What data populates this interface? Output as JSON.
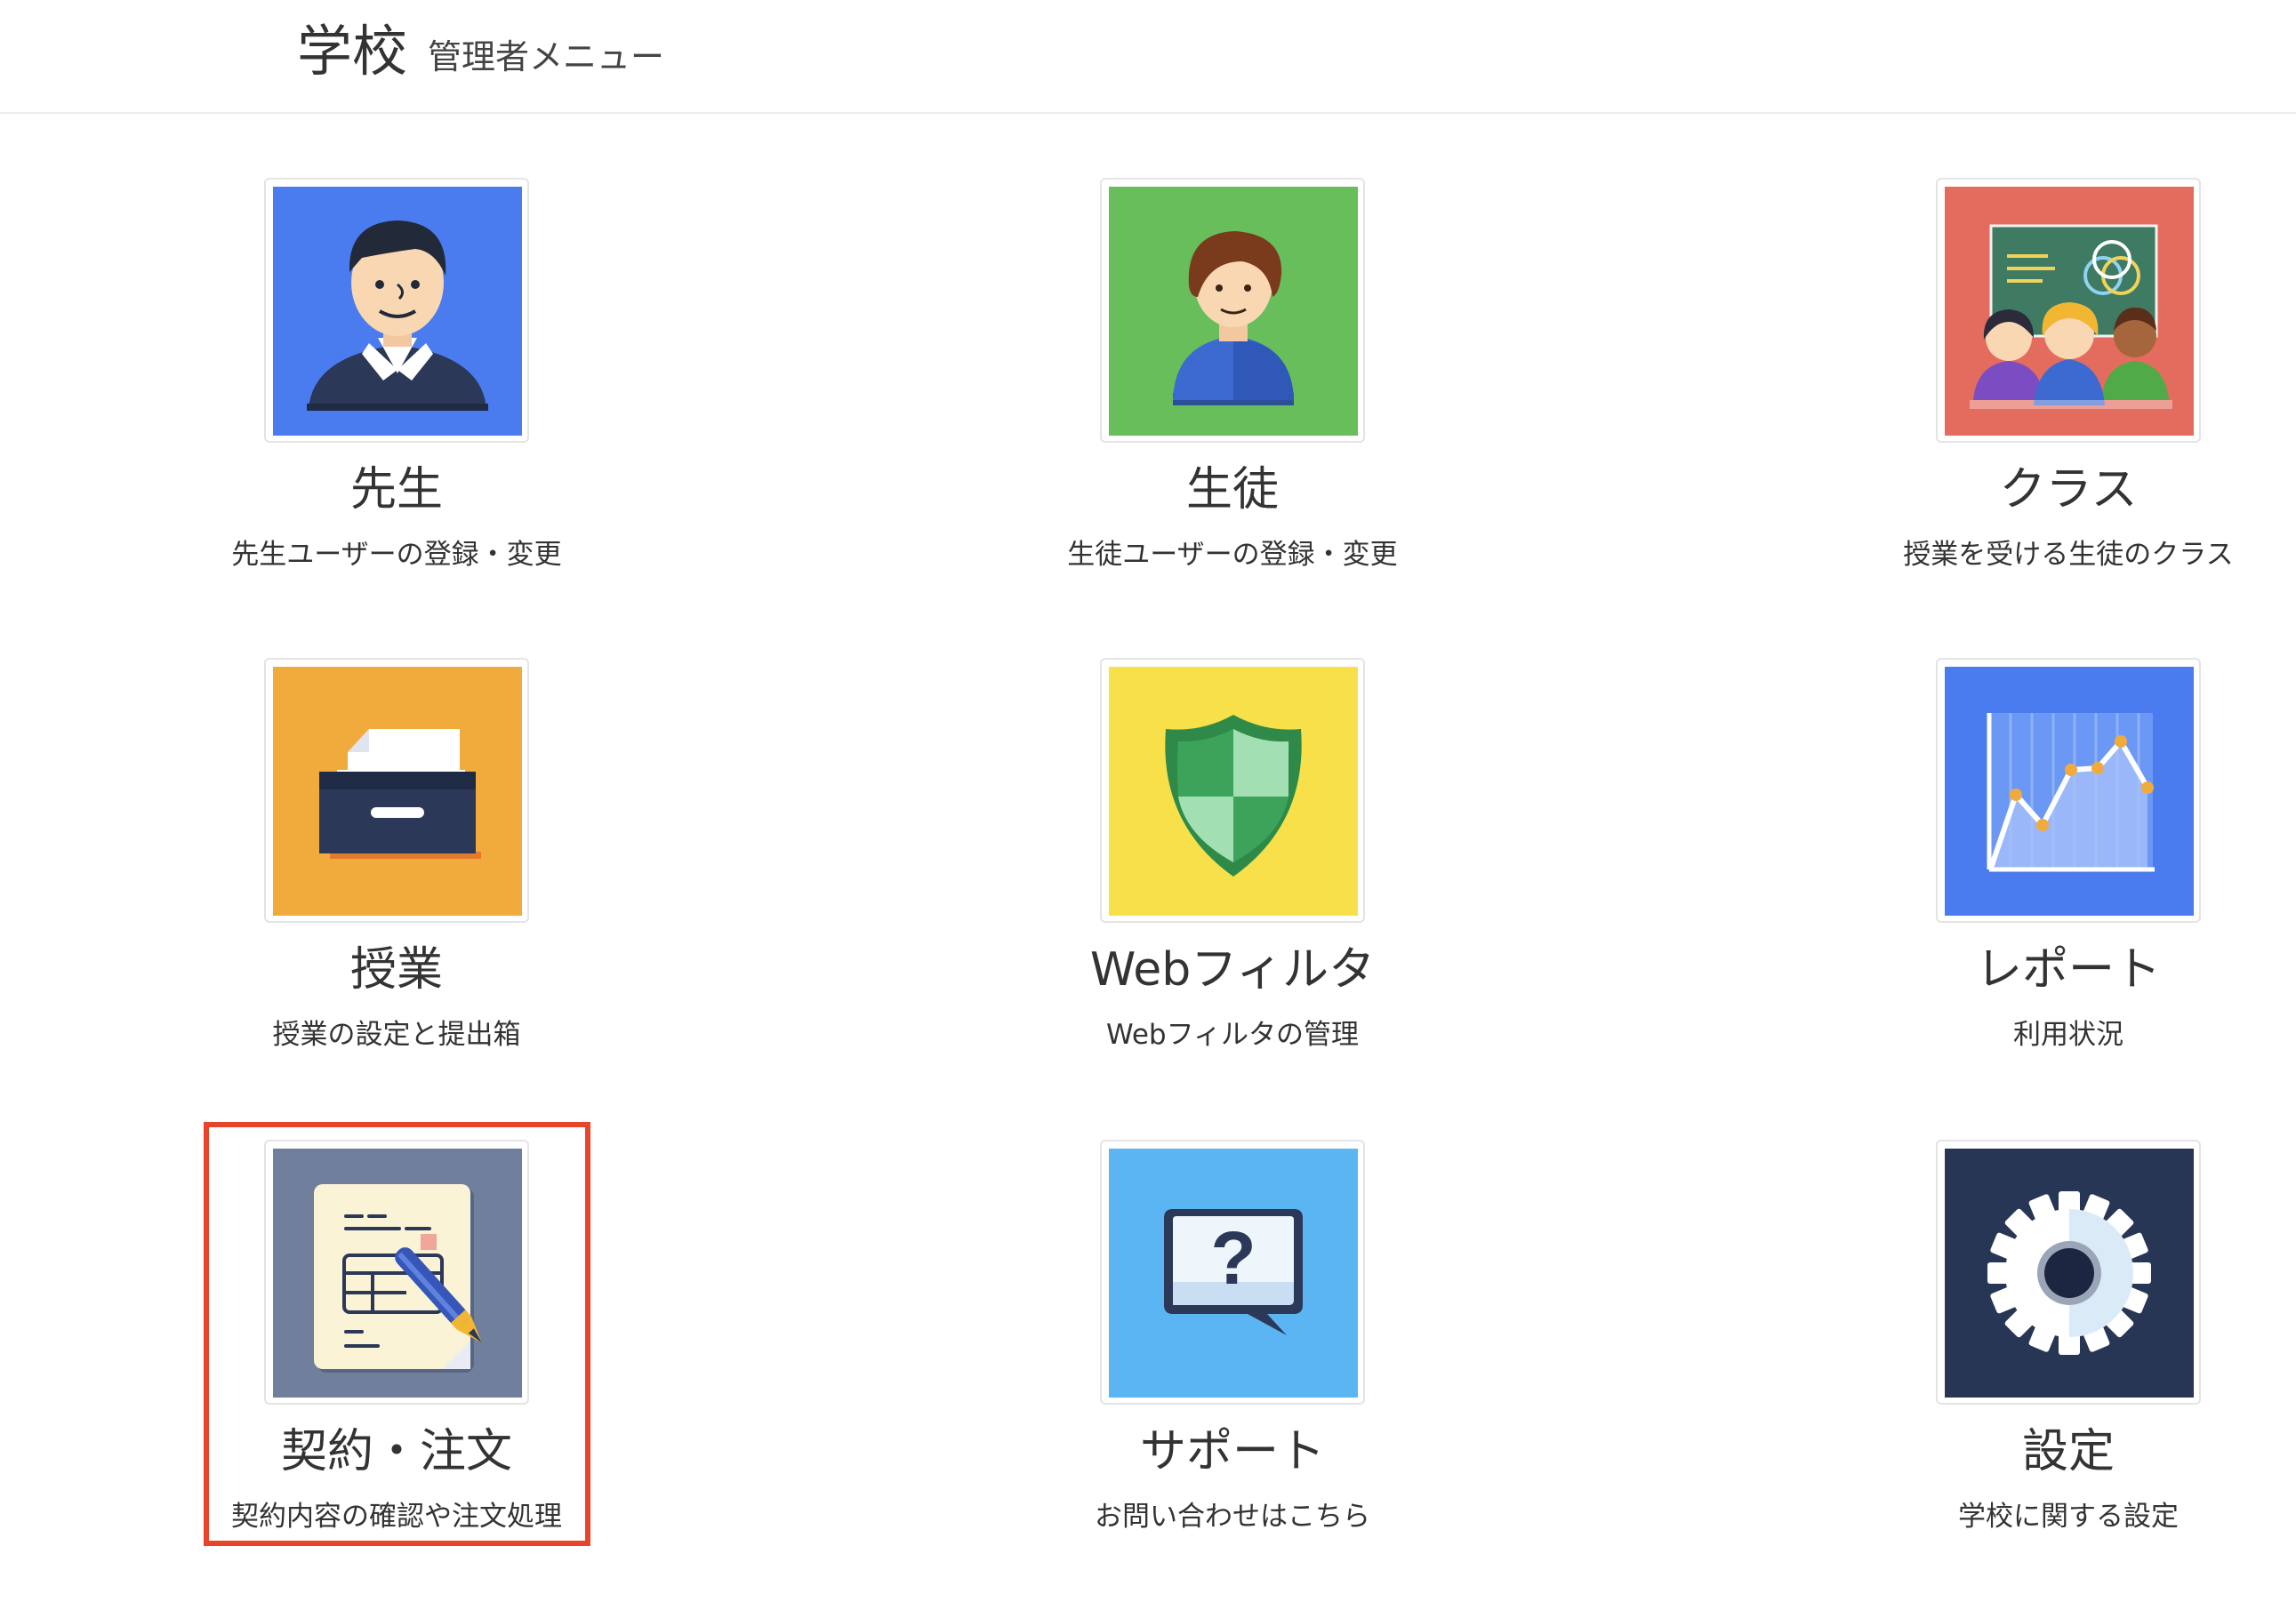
{
  "header": {
    "title": "学校",
    "subtitle": "管理者メニュー"
  },
  "menu": [
    {
      "label": "先生",
      "desc": "先生ユーザーの登録・変更",
      "icon": "teacher-icon",
      "bg": "#4a7cef"
    },
    {
      "label": "生徒",
      "desc": "生徒ユーザーの登録・変更",
      "icon": "student-icon",
      "bg": "#67be5b"
    },
    {
      "label": "クラス",
      "desc": "授業を受ける生徒のクラス",
      "icon": "class-icon",
      "bg": "#e46c5e"
    },
    {
      "label": "授業",
      "desc": "授業の設定と提出箱",
      "icon": "inbox-tray-icon",
      "bg": "#f1aa3c"
    },
    {
      "label": "Webフィルタ",
      "desc": "Webフィルタの管理",
      "icon": "shield-icon",
      "bg": "#f7e04a"
    },
    {
      "label": "レポート",
      "desc": "利用状況",
      "icon": "line-chart-icon",
      "bg": "#4a7cef"
    },
    {
      "label": "契約・注文",
      "desc": "契約内容の確認や注文処理",
      "icon": "contract-pen-icon",
      "bg": "#6f7f9c"
    },
    {
      "label": "サポート",
      "desc": "お問い合わせはこちら",
      "icon": "question-bubble-icon",
      "bg": "#5bb5f2"
    },
    {
      "label": "設定",
      "desc": "学校に関する設定",
      "icon": "gear-icon",
      "bg": "#283655"
    }
  ],
  "highlight_color": "#e8442a"
}
